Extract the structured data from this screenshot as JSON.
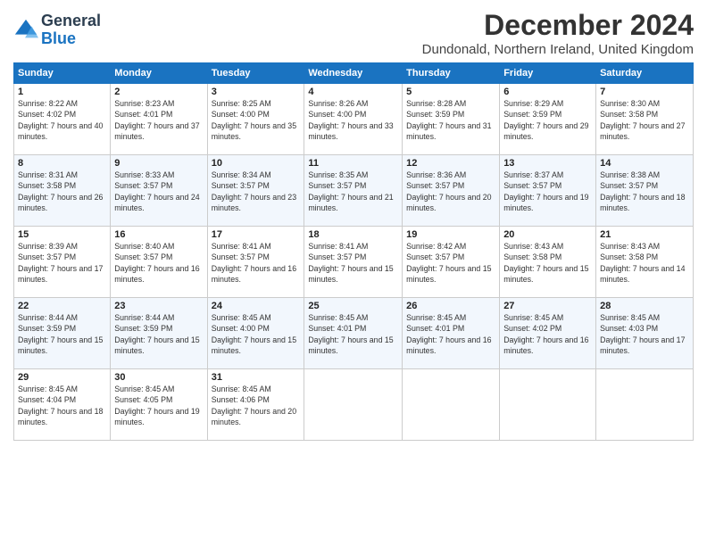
{
  "header": {
    "logo_line1": "General",
    "logo_line2": "Blue",
    "title": "December 2024",
    "subtitle": "Dundonald, Northern Ireland, United Kingdom"
  },
  "calendar": {
    "days_of_week": [
      "Sunday",
      "Monday",
      "Tuesday",
      "Wednesday",
      "Thursday",
      "Friday",
      "Saturday"
    ],
    "weeks": [
      [
        {
          "day": "1",
          "sunrise": "8:22 AM",
          "sunset": "4:02 PM",
          "daylight": "7 hours and 40 minutes."
        },
        {
          "day": "2",
          "sunrise": "8:23 AM",
          "sunset": "4:01 PM",
          "daylight": "7 hours and 37 minutes."
        },
        {
          "day": "3",
          "sunrise": "8:25 AM",
          "sunset": "4:00 PM",
          "daylight": "7 hours and 35 minutes."
        },
        {
          "day": "4",
          "sunrise": "8:26 AM",
          "sunset": "4:00 PM",
          "daylight": "7 hours and 33 minutes."
        },
        {
          "day": "5",
          "sunrise": "8:28 AM",
          "sunset": "3:59 PM",
          "daylight": "7 hours and 31 minutes."
        },
        {
          "day": "6",
          "sunrise": "8:29 AM",
          "sunset": "3:59 PM",
          "daylight": "7 hours and 29 minutes."
        },
        {
          "day": "7",
          "sunrise": "8:30 AM",
          "sunset": "3:58 PM",
          "daylight": "7 hours and 27 minutes."
        }
      ],
      [
        {
          "day": "8",
          "sunrise": "8:31 AM",
          "sunset": "3:58 PM",
          "daylight": "7 hours and 26 minutes."
        },
        {
          "day": "9",
          "sunrise": "8:33 AM",
          "sunset": "3:57 PM",
          "daylight": "7 hours and 24 minutes."
        },
        {
          "day": "10",
          "sunrise": "8:34 AM",
          "sunset": "3:57 PM",
          "daylight": "7 hours and 23 minutes."
        },
        {
          "day": "11",
          "sunrise": "8:35 AM",
          "sunset": "3:57 PM",
          "daylight": "7 hours and 21 minutes."
        },
        {
          "day": "12",
          "sunrise": "8:36 AM",
          "sunset": "3:57 PM",
          "daylight": "7 hours and 20 minutes."
        },
        {
          "day": "13",
          "sunrise": "8:37 AM",
          "sunset": "3:57 PM",
          "daylight": "7 hours and 19 minutes."
        },
        {
          "day": "14",
          "sunrise": "8:38 AM",
          "sunset": "3:57 PM",
          "daylight": "7 hours and 18 minutes."
        }
      ],
      [
        {
          "day": "15",
          "sunrise": "8:39 AM",
          "sunset": "3:57 PM",
          "daylight": "7 hours and 17 minutes."
        },
        {
          "day": "16",
          "sunrise": "8:40 AM",
          "sunset": "3:57 PM",
          "daylight": "7 hours and 16 minutes."
        },
        {
          "day": "17",
          "sunrise": "8:41 AM",
          "sunset": "3:57 PM",
          "daylight": "7 hours and 16 minutes."
        },
        {
          "day": "18",
          "sunrise": "8:41 AM",
          "sunset": "3:57 PM",
          "daylight": "7 hours and 15 minutes."
        },
        {
          "day": "19",
          "sunrise": "8:42 AM",
          "sunset": "3:57 PM",
          "daylight": "7 hours and 15 minutes."
        },
        {
          "day": "20",
          "sunrise": "8:43 AM",
          "sunset": "3:58 PM",
          "daylight": "7 hours and 15 minutes."
        },
        {
          "day": "21",
          "sunrise": "8:43 AM",
          "sunset": "3:58 PM",
          "daylight": "7 hours and 14 minutes."
        }
      ],
      [
        {
          "day": "22",
          "sunrise": "8:44 AM",
          "sunset": "3:59 PM",
          "daylight": "7 hours and 15 minutes."
        },
        {
          "day": "23",
          "sunrise": "8:44 AM",
          "sunset": "3:59 PM",
          "daylight": "7 hours and 15 minutes."
        },
        {
          "day": "24",
          "sunrise": "8:45 AM",
          "sunset": "4:00 PM",
          "daylight": "7 hours and 15 minutes."
        },
        {
          "day": "25",
          "sunrise": "8:45 AM",
          "sunset": "4:01 PM",
          "daylight": "7 hours and 15 minutes."
        },
        {
          "day": "26",
          "sunrise": "8:45 AM",
          "sunset": "4:01 PM",
          "daylight": "7 hours and 16 minutes."
        },
        {
          "day": "27",
          "sunrise": "8:45 AM",
          "sunset": "4:02 PM",
          "daylight": "7 hours and 16 minutes."
        },
        {
          "day": "28",
          "sunrise": "8:45 AM",
          "sunset": "4:03 PM",
          "daylight": "7 hours and 17 minutes."
        }
      ],
      [
        {
          "day": "29",
          "sunrise": "8:45 AM",
          "sunset": "4:04 PM",
          "daylight": "7 hours and 18 minutes."
        },
        {
          "day": "30",
          "sunrise": "8:45 AM",
          "sunset": "4:05 PM",
          "daylight": "7 hours and 19 minutes."
        },
        {
          "day": "31",
          "sunrise": "8:45 AM",
          "sunset": "4:06 PM",
          "daylight": "7 hours and 20 minutes."
        },
        null,
        null,
        null,
        null
      ]
    ]
  }
}
